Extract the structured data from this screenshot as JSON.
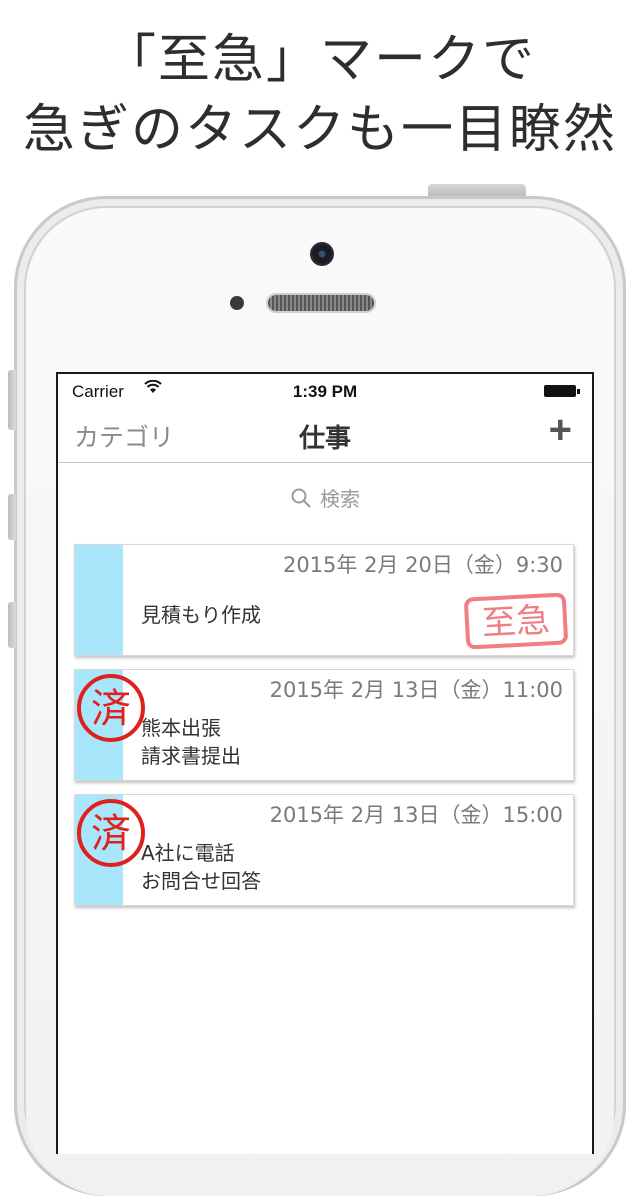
{
  "headline": {
    "line1": "「至急」マークで",
    "line2": "急ぎのタスクも一目瞭然"
  },
  "status_bar": {
    "carrier": "Carrier",
    "time": "1:39 PM"
  },
  "nav": {
    "left_label": "カテゴリ",
    "title": "仕事",
    "add_label": "+"
  },
  "search": {
    "placeholder": "検索"
  },
  "tasks": [
    {
      "date": "2015年 2月 20日（金）9:30",
      "lines": [
        "見積もり作成",
        ""
      ],
      "stamp": "至急"
    },
    {
      "date": "2015年 2月 13日（金）11:00",
      "lines": [
        "熊本出張",
        "請求書提出"
      ],
      "stamp": "済"
    },
    {
      "date": "2015年 2月 13日（金）15:00",
      "lines": [
        "A社に電話",
        "お問合せ回答"
      ],
      "stamp": "済"
    }
  ],
  "colors": {
    "stripe": "#a8e6fb",
    "stamp_red": "#e0201c",
    "urgent_pink": "#ef7e84"
  }
}
